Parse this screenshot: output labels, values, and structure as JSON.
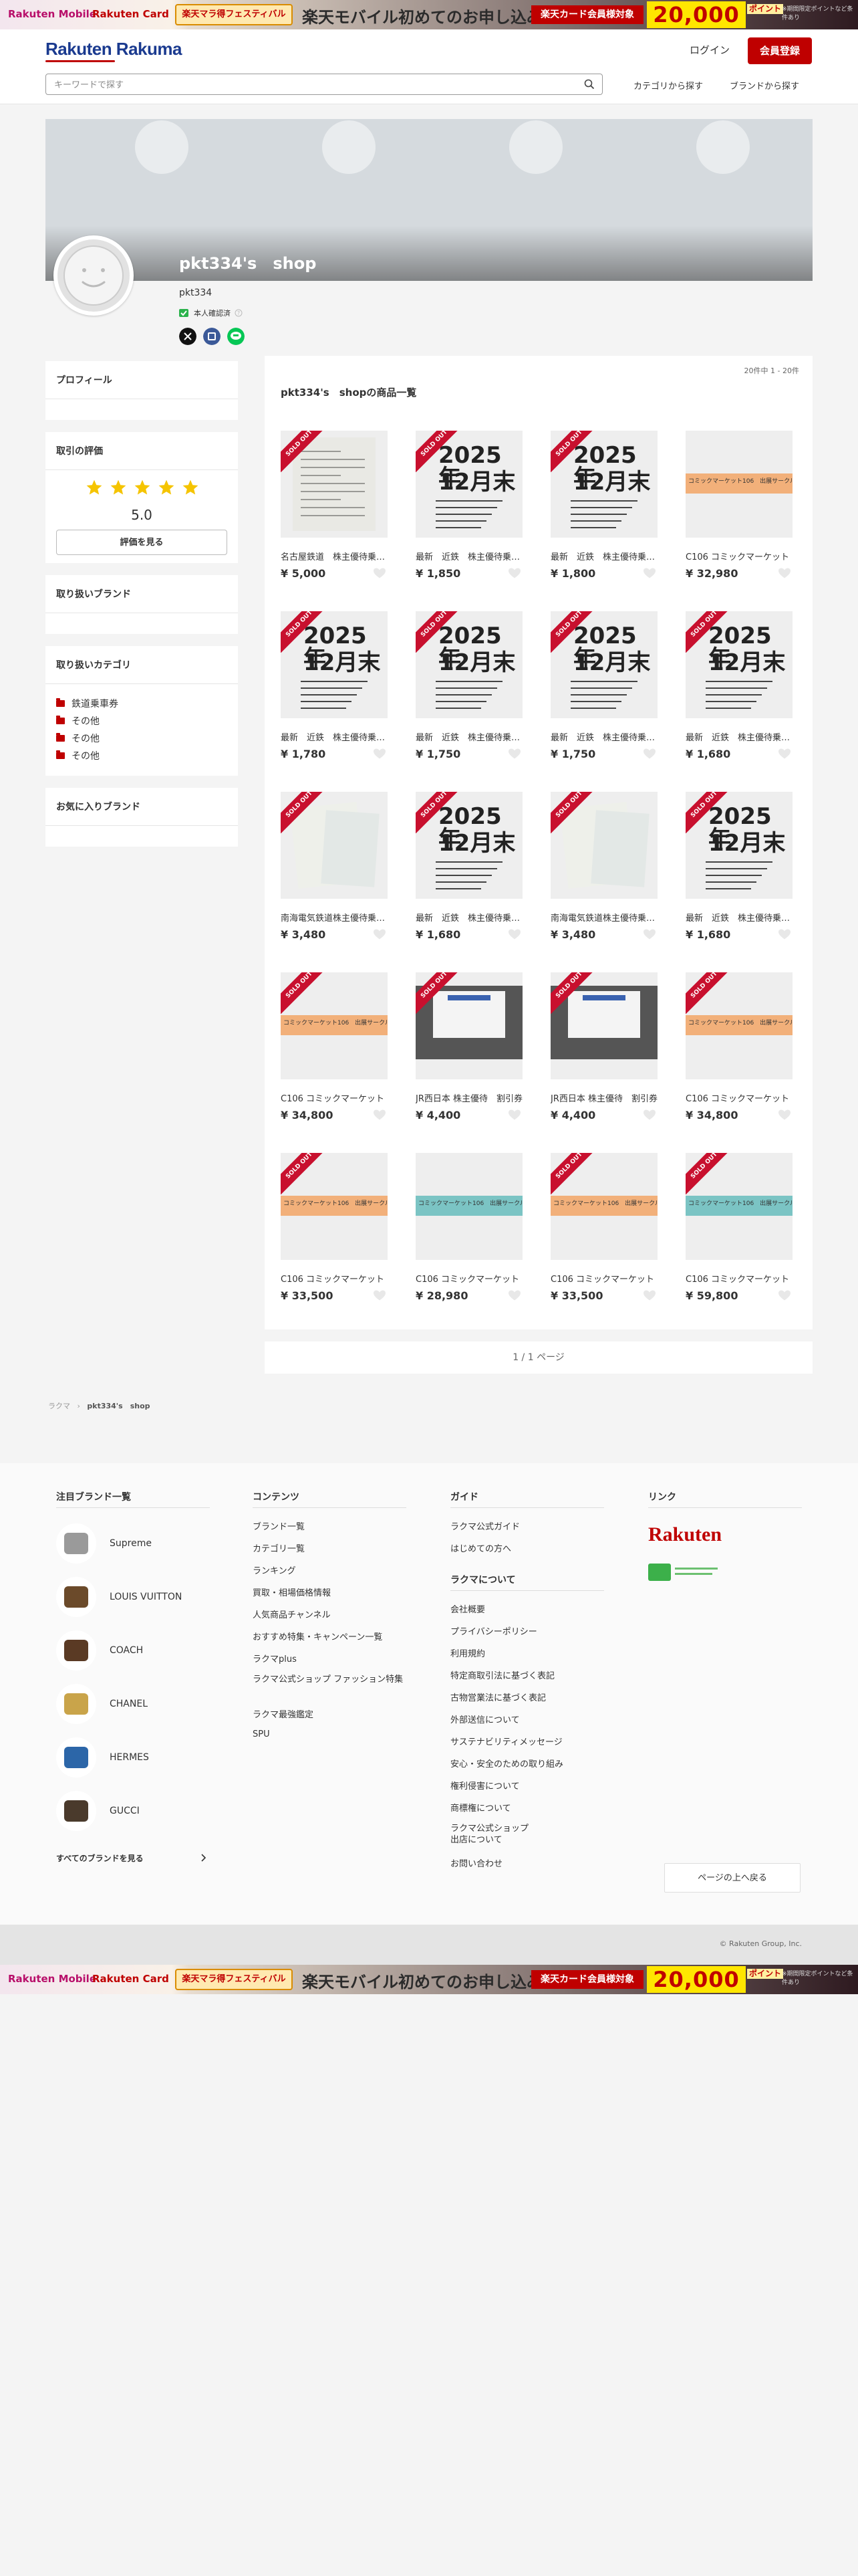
{
  "promo": {
    "mobile": "Rakuten Mobile",
    "card": "Rakuten Card",
    "festival": "楽天マラ得フェスティバル",
    "headline": "楽天モバイル初めてのお申し込みで",
    "card_target": "楽天カード会員様対象",
    "points": "20,000",
    "point_unit": "ポイント",
    "note": "※期間限定ポイントなど条件あり"
  },
  "header": {
    "logo": "Rakuten Rakuma",
    "login": "ログイン",
    "signup": "会員登録",
    "search_placeholder": "キーワードで探す",
    "category_link": "カテゴリから探す",
    "brand_link": "ブランドから探す"
  },
  "shop": {
    "name": "pkt334's　shop",
    "user_id": "pkt334",
    "verified": "本人確認済"
  },
  "sidebar": {
    "profile": "プロフィール",
    "rating_title": "取引の評価",
    "rating_score": "5.0",
    "rating_stars": 5,
    "review_button": "評価を見る",
    "brands_title": "取り扱いブランド",
    "categories_title": "取り扱いカテゴリ",
    "categories": [
      "鉄道乗車券",
      "その他",
      "その他",
      "その他"
    ],
    "favorite_brands": "お気に入りブランド"
  },
  "products": {
    "count": "20件中 1 - 20件",
    "list_title": "pkt334's　shopの商品一覧",
    "sold_label": "SOLD OUT",
    "items": [
      {
        "name": "名古屋鉄道　株主優待乗車証",
        "price": "¥ 5,000",
        "type": "doc",
        "sold": true
      },
      {
        "name": "最新　近鉄　株主優待乗車券",
        "price": "¥ 1,850",
        "type": "ticket",
        "sold": true
      },
      {
        "name": "最新　近鉄　株主優待乗車券",
        "price": "¥ 1,800",
        "type": "ticket",
        "sold": true
      },
      {
        "name": "C106 コミックマーケット",
        "price": "¥ 32,980",
        "type": "comic",
        "sold": false
      },
      {
        "name": "最新　近鉄　株主優待乗車券",
        "price": "¥ 1,780",
        "type": "ticket",
        "sold": true
      },
      {
        "name": "最新　近鉄　株主優待乗車券",
        "price": "¥ 1,750",
        "type": "ticket",
        "sold": true
      },
      {
        "name": "最新　近鉄　株主優待乗車券",
        "price": "¥ 1,750",
        "type": "ticket",
        "sold": true
      },
      {
        "name": "最新　近鉄　株主優待乗車券",
        "price": "¥ 1,680",
        "type": "ticket",
        "sold": true
      },
      {
        "name": "南海電気鉄道株主優待乗車証",
        "price": "¥ 3,480",
        "type": "nankai",
        "sold": true
      },
      {
        "name": "最新　近鉄　株主優待乗車券",
        "price": "¥ 1,680",
        "type": "ticket",
        "sold": true
      },
      {
        "name": "南海電気鉄道株主優待乗車証",
        "price": "¥ 3,480",
        "type": "nankai",
        "sold": true
      },
      {
        "name": "最新　近鉄　株主優待乗車券",
        "price": "¥ 1,680",
        "type": "ticket",
        "sold": true
      },
      {
        "name": "C106 コミックマーケット",
        "price": "¥ 34,800",
        "type": "comic",
        "sold": true
      },
      {
        "name": "JR西日本 株主優待　割引券",
        "price": "¥ 4,400",
        "type": "jr",
        "sold": true
      },
      {
        "name": "JR西日本 株主優待　割引券",
        "price": "¥ 4,400",
        "type": "jr",
        "sold": true
      },
      {
        "name": "C106 コミックマーケット",
        "price": "¥ 34,800",
        "type": "comic",
        "sold": true
      },
      {
        "name": "C106 コミックマーケット",
        "price": "¥ 33,500",
        "type": "comic",
        "sold": true
      },
      {
        "name": "C106 コミックマーケット",
        "price": "¥ 28,980",
        "type": "comic2",
        "sold": false
      },
      {
        "name": "C106 コミックマーケット",
        "price": "¥ 33,500",
        "type": "comic",
        "sold": true
      },
      {
        "name": "C106 コミックマーケット",
        "price": "¥ 59,800",
        "type": "comic2",
        "sold": true
      }
    ],
    "ticket_year": "2025年",
    "ticket_month": "12月末",
    "comic_text": "コミックマーケット106　出展サークル"
  },
  "pager": "1 / 1 ページ",
  "breadcrumb": {
    "home": "ラクマ",
    "current": "pkt334's　shop"
  },
  "footer": {
    "brands_title": "注目ブランド一覧",
    "brands": [
      "Supreme",
      "LOUIS VUITTON",
      "COACH",
      "CHANEL",
      "HERMES",
      "GUCCI"
    ],
    "all_brands": "すべてのブランドを見る",
    "contents_title": "コンテンツ",
    "contents": [
      "ブランド一覧",
      "カテゴリ一覧",
      "ランキング",
      "買取・相場価格情報",
      "人気商品チャンネル",
      "おすすめ特集・キャンペーン一覧",
      "ラクマplus",
      "ラクマ公式ショップ ファッション特集",
      "ラクマ最強鑑定",
      "SPU"
    ],
    "guide_title": "ガイド",
    "guide": [
      "ラクマ公式ガイド",
      "はじめての方へ"
    ],
    "about_title": "ラクマについて",
    "about": [
      "会社概要",
      "プライバシーポリシー",
      "利用規約",
      "特定商取引法に基づく表記",
      "古物営業法に基づく表記",
      "外部送信について",
      "サステナビリティメッセージ",
      "安心・安全のための取り組み",
      "権利侵害について",
      "商標権について",
      "ラクマ公式ショップ 出店について",
      "お問い合わせ"
    ],
    "link_title": "リンク",
    "rakuten_logo": "Rakuten",
    "back_to_top": "ページの上へ戻る",
    "copyright": "© Rakuten Group, Inc."
  }
}
